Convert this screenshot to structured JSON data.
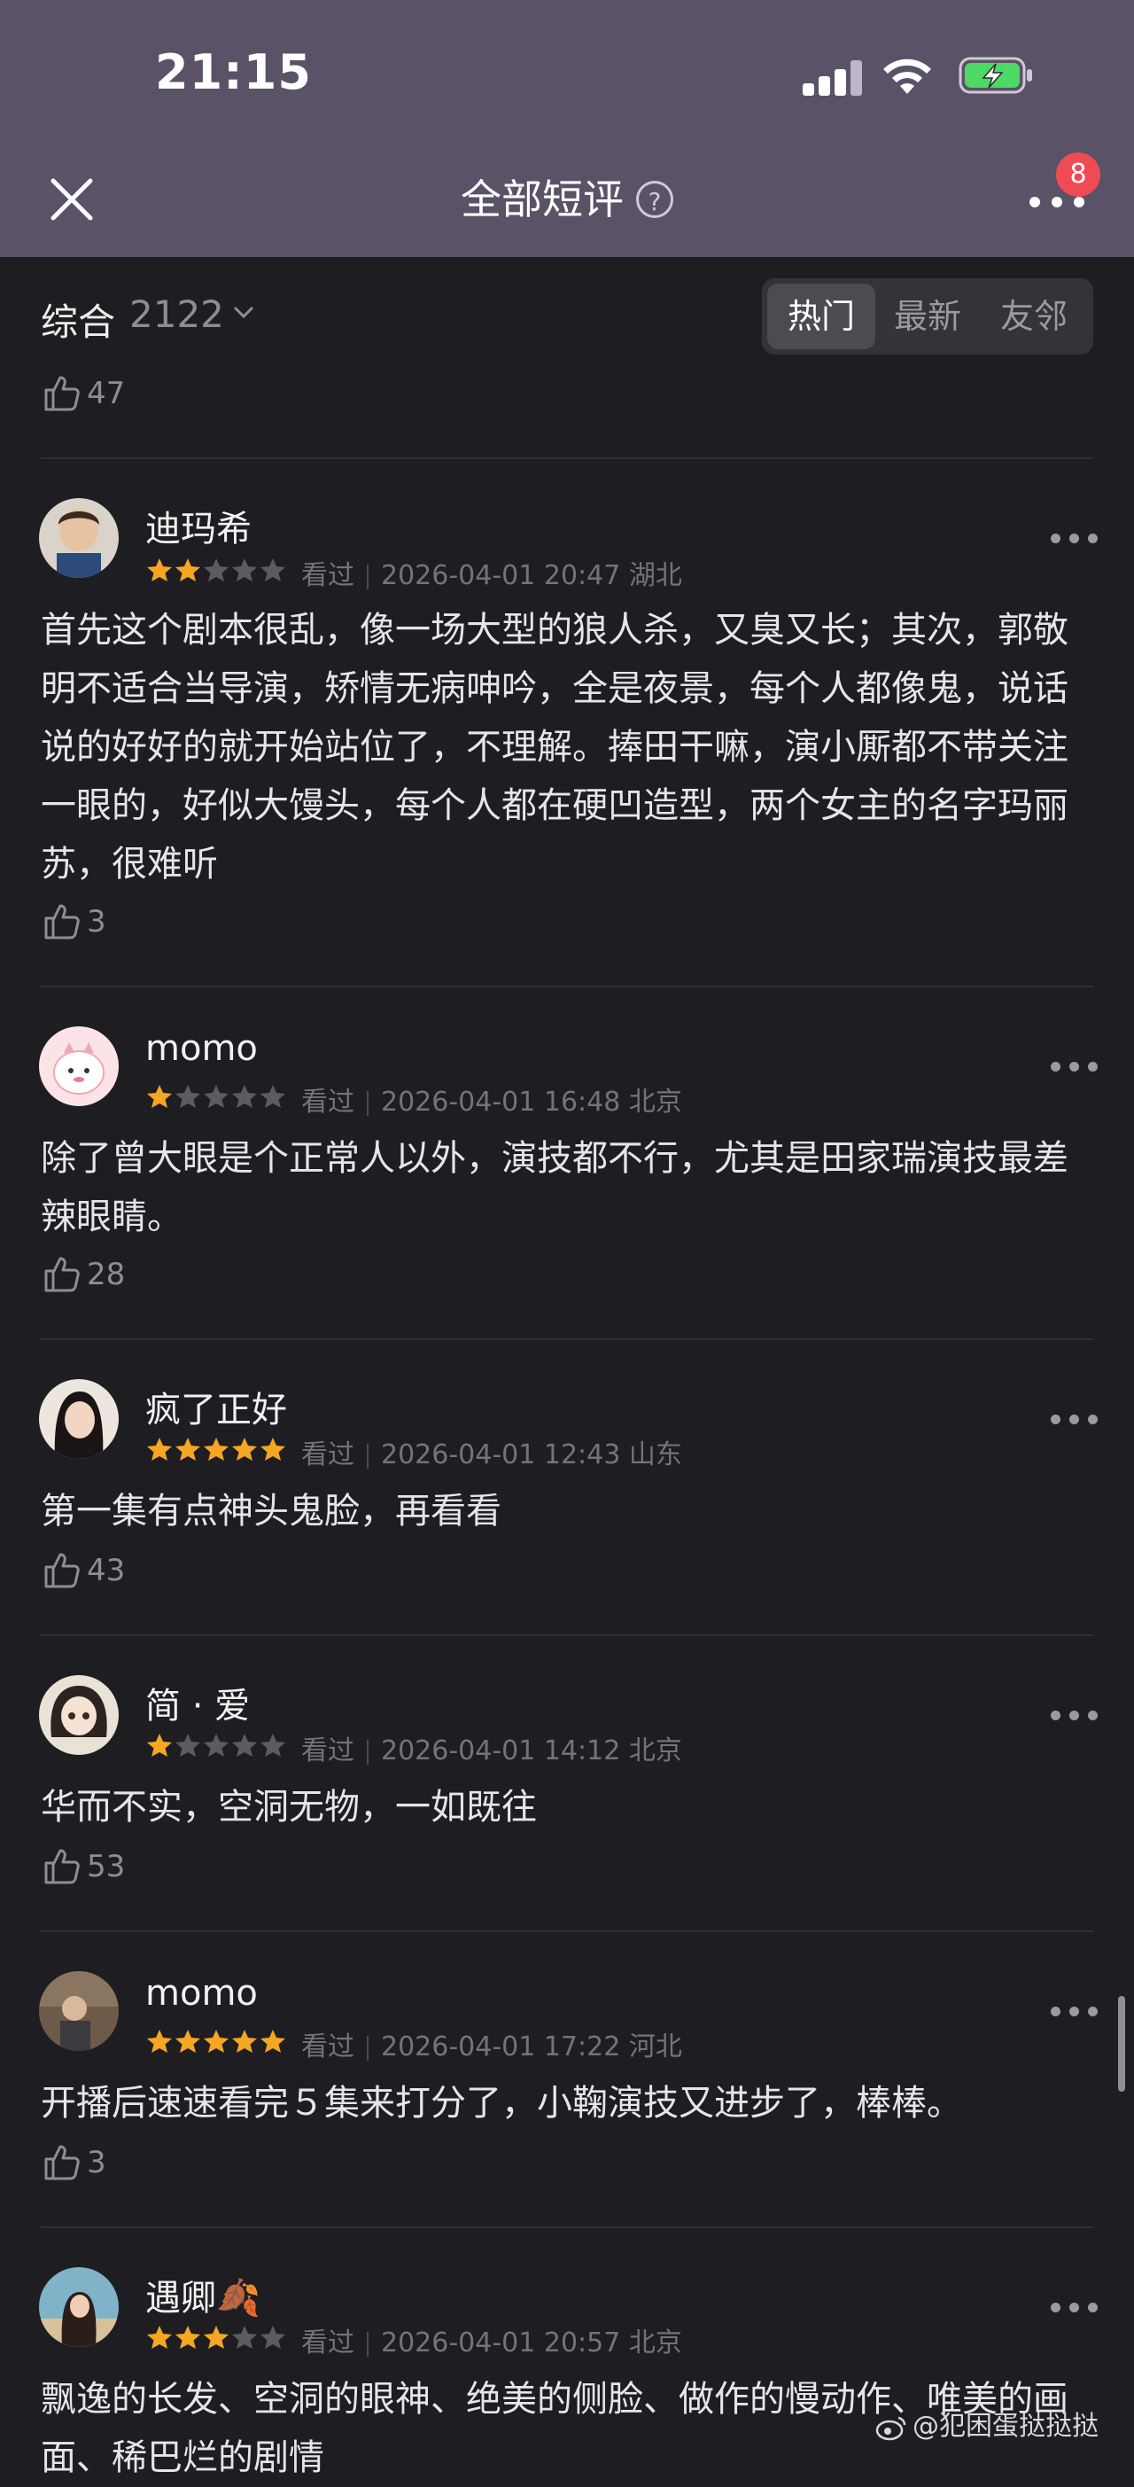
{
  "status_bar": {
    "time": "21:15"
  },
  "header": {
    "title": "全部短评",
    "help_icon": "?",
    "badge_count": "8"
  },
  "filter": {
    "sort_label": "综合",
    "count": "2122",
    "tabs": [
      {
        "label": "热门",
        "active": true
      },
      {
        "label": "最新",
        "active": false
      },
      {
        "label": "友邻",
        "active": false
      }
    ]
  },
  "previous_likes": "47",
  "reviews": [
    {
      "name": "迪玛希",
      "stars": 2,
      "watched": "看过",
      "datetime": "2026-04-01 20:47",
      "location": "湖北",
      "content": "首先这个剧本很乱，像一场大型的狼人杀，又臭又长；其次，郭敬明不适合当导演，矫情无病呻吟，全是夜景，每个人都像鬼，说话说的好好的就开始站位了，不理解。捧田干嘛，演小厮都不带关注一眼的，好似大馒头，每个人都在硬凹造型，两个女主的名字玛丽苏，很难听",
      "likes": "3",
      "avatar": "avatar-boy"
    },
    {
      "name": "momo",
      "stars": 1,
      "watched": "看过",
      "datetime": "2026-04-01 16:48",
      "location": "北京",
      "content": "除了曾大眼是个正常人以外，演技都不行，尤其是田家瑞演技最差辣眼睛。",
      "likes": "28",
      "avatar": "avatar-pink-cartoon"
    },
    {
      "name": "疯了正好",
      "stars": 5,
      "watched": "看过",
      "datetime": "2026-04-01 12:43",
      "location": "山东",
      "content": "第一集有点神头鬼脸，再看看",
      "likes": "43",
      "avatar": "avatar-girl"
    },
    {
      "name": "简 · 爱",
      "stars": 1,
      "watched": "看过",
      "datetime": "2026-04-01 14:12",
      "location": "北京",
      "content": "华而不实，空洞无物，一如既往",
      "likes": "53",
      "avatar": "avatar-anime"
    },
    {
      "name": "momo",
      "stars": 5,
      "watched": "看过",
      "datetime": "2026-04-01 17:22",
      "location": "河北",
      "content": "开播后速速看完５集来打分了，小鞠演技又进步了，棒棒。",
      "likes": "3",
      "avatar": "avatar-room"
    },
    {
      "name": "遇卿🍂",
      "stars": 3,
      "watched": "看过",
      "datetime": "2026-04-01 20:57",
      "location": "北京",
      "content": "飘逸的长发、空洞的眼神、绝美的侧脸、做作的慢动作、唯美的画面、稀巴烂的剧情",
      "likes": "",
      "avatar": "avatar-beach"
    }
  ],
  "colors": {
    "header_bg": "#5a5266",
    "page_bg": "#1e1e22",
    "star_on": "#f5a623",
    "star_off": "#5b5b62",
    "badge": "#f04a55"
  },
  "watermark": "@犯困蛋挞挞挞"
}
